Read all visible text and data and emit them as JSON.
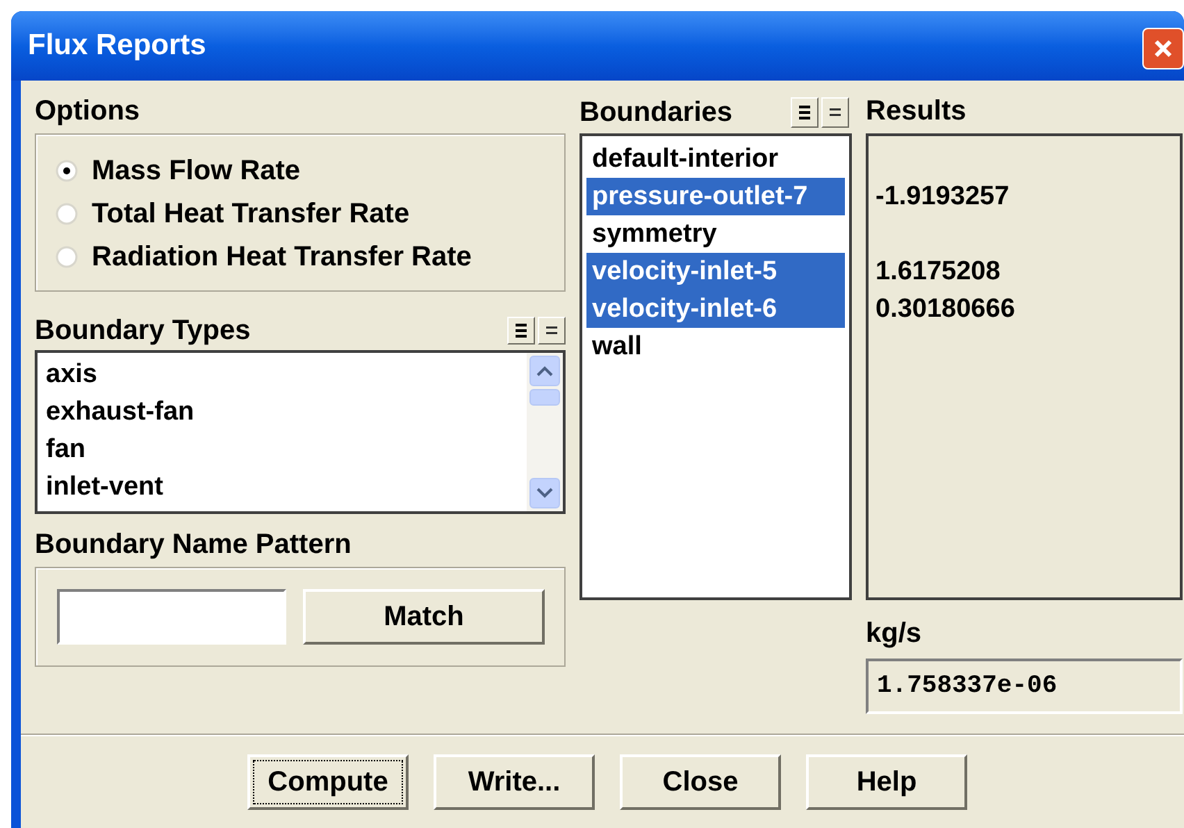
{
  "window": {
    "title": "Flux Reports"
  },
  "options": {
    "label": "Options",
    "items": [
      {
        "label": "Mass Flow Rate",
        "selected": true
      },
      {
        "label": "Total Heat Transfer Rate",
        "selected": false
      },
      {
        "label": "Radiation Heat Transfer Rate",
        "selected": false
      }
    ]
  },
  "boundary_types": {
    "label": "Boundary Types",
    "items": [
      {
        "label": "axis",
        "selected": false
      },
      {
        "label": "exhaust-fan",
        "selected": false
      },
      {
        "label": "fan",
        "selected": false
      },
      {
        "label": "inlet-vent",
        "selected": false
      }
    ]
  },
  "boundary_name_pattern": {
    "label": "Boundary Name Pattern",
    "button": "Match"
  },
  "boundaries": {
    "label": "Boundaries",
    "items": [
      {
        "label": "default-interior",
        "selected": false
      },
      {
        "label": "pressure-outlet-7",
        "selected": true,
        "result": "-1.9193257"
      },
      {
        "label": "symmetry",
        "selected": false
      },
      {
        "label": "velocity-inlet-5",
        "selected": true,
        "result": "1.6175208"
      },
      {
        "label": "velocity-inlet-6",
        "selected": true,
        "result": "0.30180666"
      },
      {
        "label": "wall",
        "selected": false
      }
    ]
  },
  "results": {
    "label": "Results",
    "unit": "kg/s",
    "net": "1.758337e-06"
  },
  "buttons": [
    {
      "label": "Compute",
      "focused": true
    },
    {
      "label": "Write...",
      "focused": false
    },
    {
      "label": "Close",
      "focused": false
    },
    {
      "label": "Help",
      "focused": false
    }
  ]
}
